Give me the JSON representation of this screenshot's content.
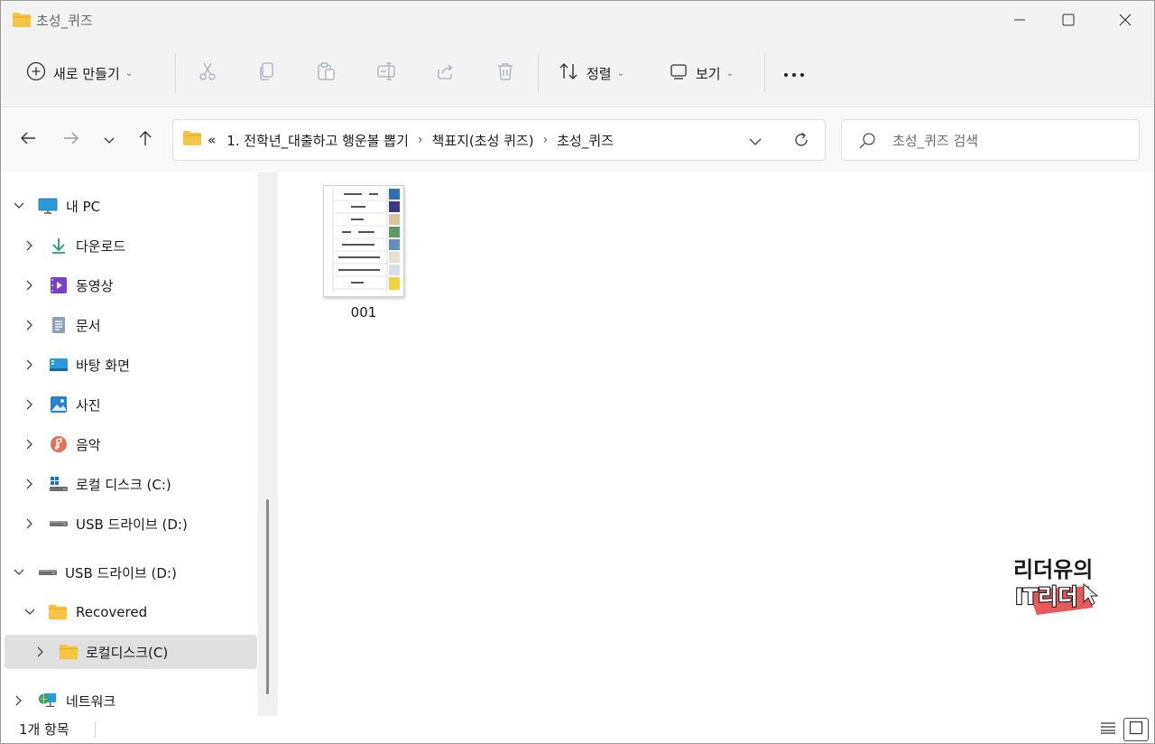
{
  "window": {
    "title": "초성_퀴즈"
  },
  "toolbar": {
    "new_label": "새로 만들기",
    "sort_label": "정렬",
    "view_label": "보기",
    "more_label": "···"
  },
  "address": {
    "overflow": "«",
    "crumbs": [
      "1. 전학년_대출하고 행운볼 뽑기",
      "책표지(초성 퀴즈)",
      "초성_퀴즈"
    ]
  },
  "search": {
    "placeholder": "초성_퀴즈 검색"
  },
  "nav": {
    "items": [
      {
        "label": "내 PC"
      },
      {
        "label": "다운로드"
      },
      {
        "label": "동영상"
      },
      {
        "label": "문서"
      },
      {
        "label": "바탕 화면"
      },
      {
        "label": "사진"
      },
      {
        "label": "음악"
      },
      {
        "label": "로컬 디스크 (C:)"
      },
      {
        "label": "USB 드라이브 (D:)"
      },
      {
        "label": "USB 드라이브 (D:)"
      },
      {
        "label": "Recovered"
      },
      {
        "label": "로컬디스크(C)"
      },
      {
        "label": "네트워크"
      }
    ]
  },
  "content": {
    "files": [
      {
        "name": "001"
      }
    ],
    "watermark": {
      "line1": "리더유의",
      "line2": "IT리더"
    }
  },
  "status": {
    "item_count": "1개 항목"
  },
  "colors": {
    "folder_yellow": "#f7c544",
    "folder_dark": "#e8a917",
    "accent_blue": "#0067c0",
    "selected_bg": "#e0e0e0"
  }
}
